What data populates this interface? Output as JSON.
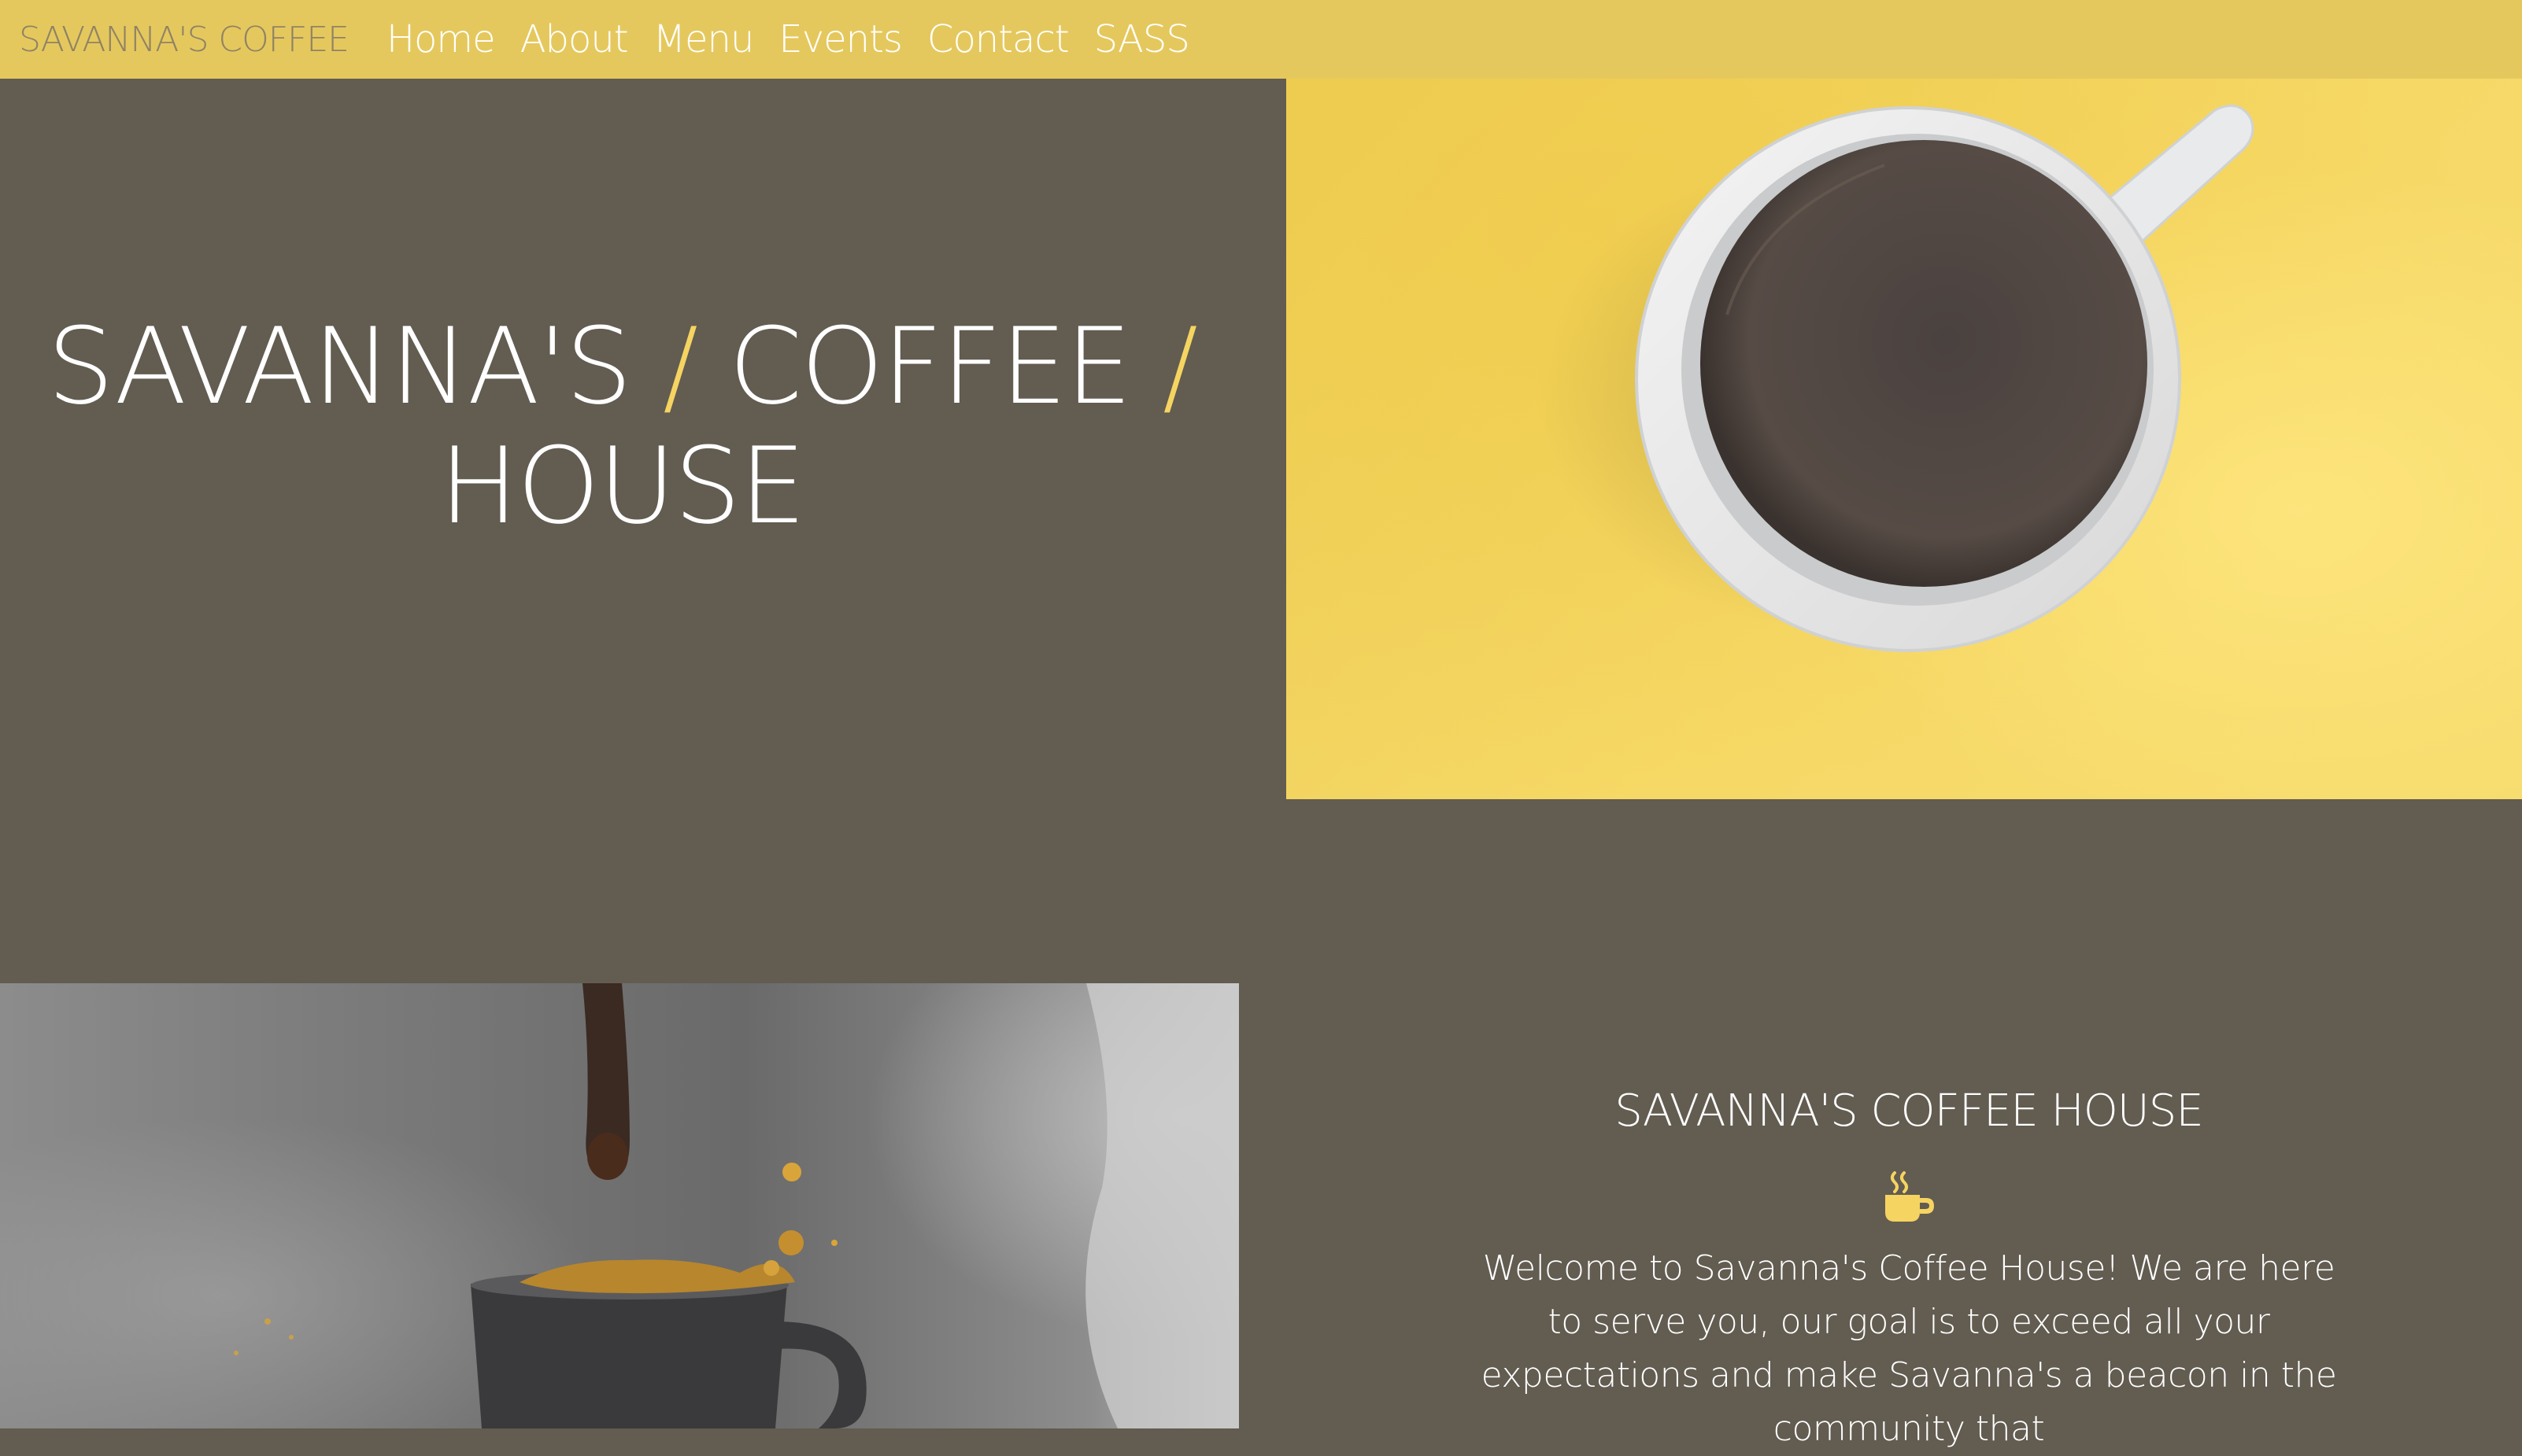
{
  "nav": {
    "brand": "SAVANNA'S COFFEE",
    "links": [
      "Home",
      "About",
      "Menu",
      "Events",
      "Contact",
      "SASS"
    ]
  },
  "hero": {
    "title_word1": "SAVANNA'S",
    "slash": "/",
    "title_word2": "COFFEE",
    "title_word3": "HOUSE"
  },
  "welcome": {
    "title": "SAVANNA'S COFFEE HOUSE",
    "icon": "coffee-cup-icon",
    "text": "Welcome to Savanna's Coffee House! We are here to serve you, our goal is to exceed all your expectations and make Savanna's a beacon in the community that"
  },
  "colors": {
    "nav_bg": "#e5c85d",
    "page_bg": "#625c51",
    "accent": "#f5d461"
  }
}
